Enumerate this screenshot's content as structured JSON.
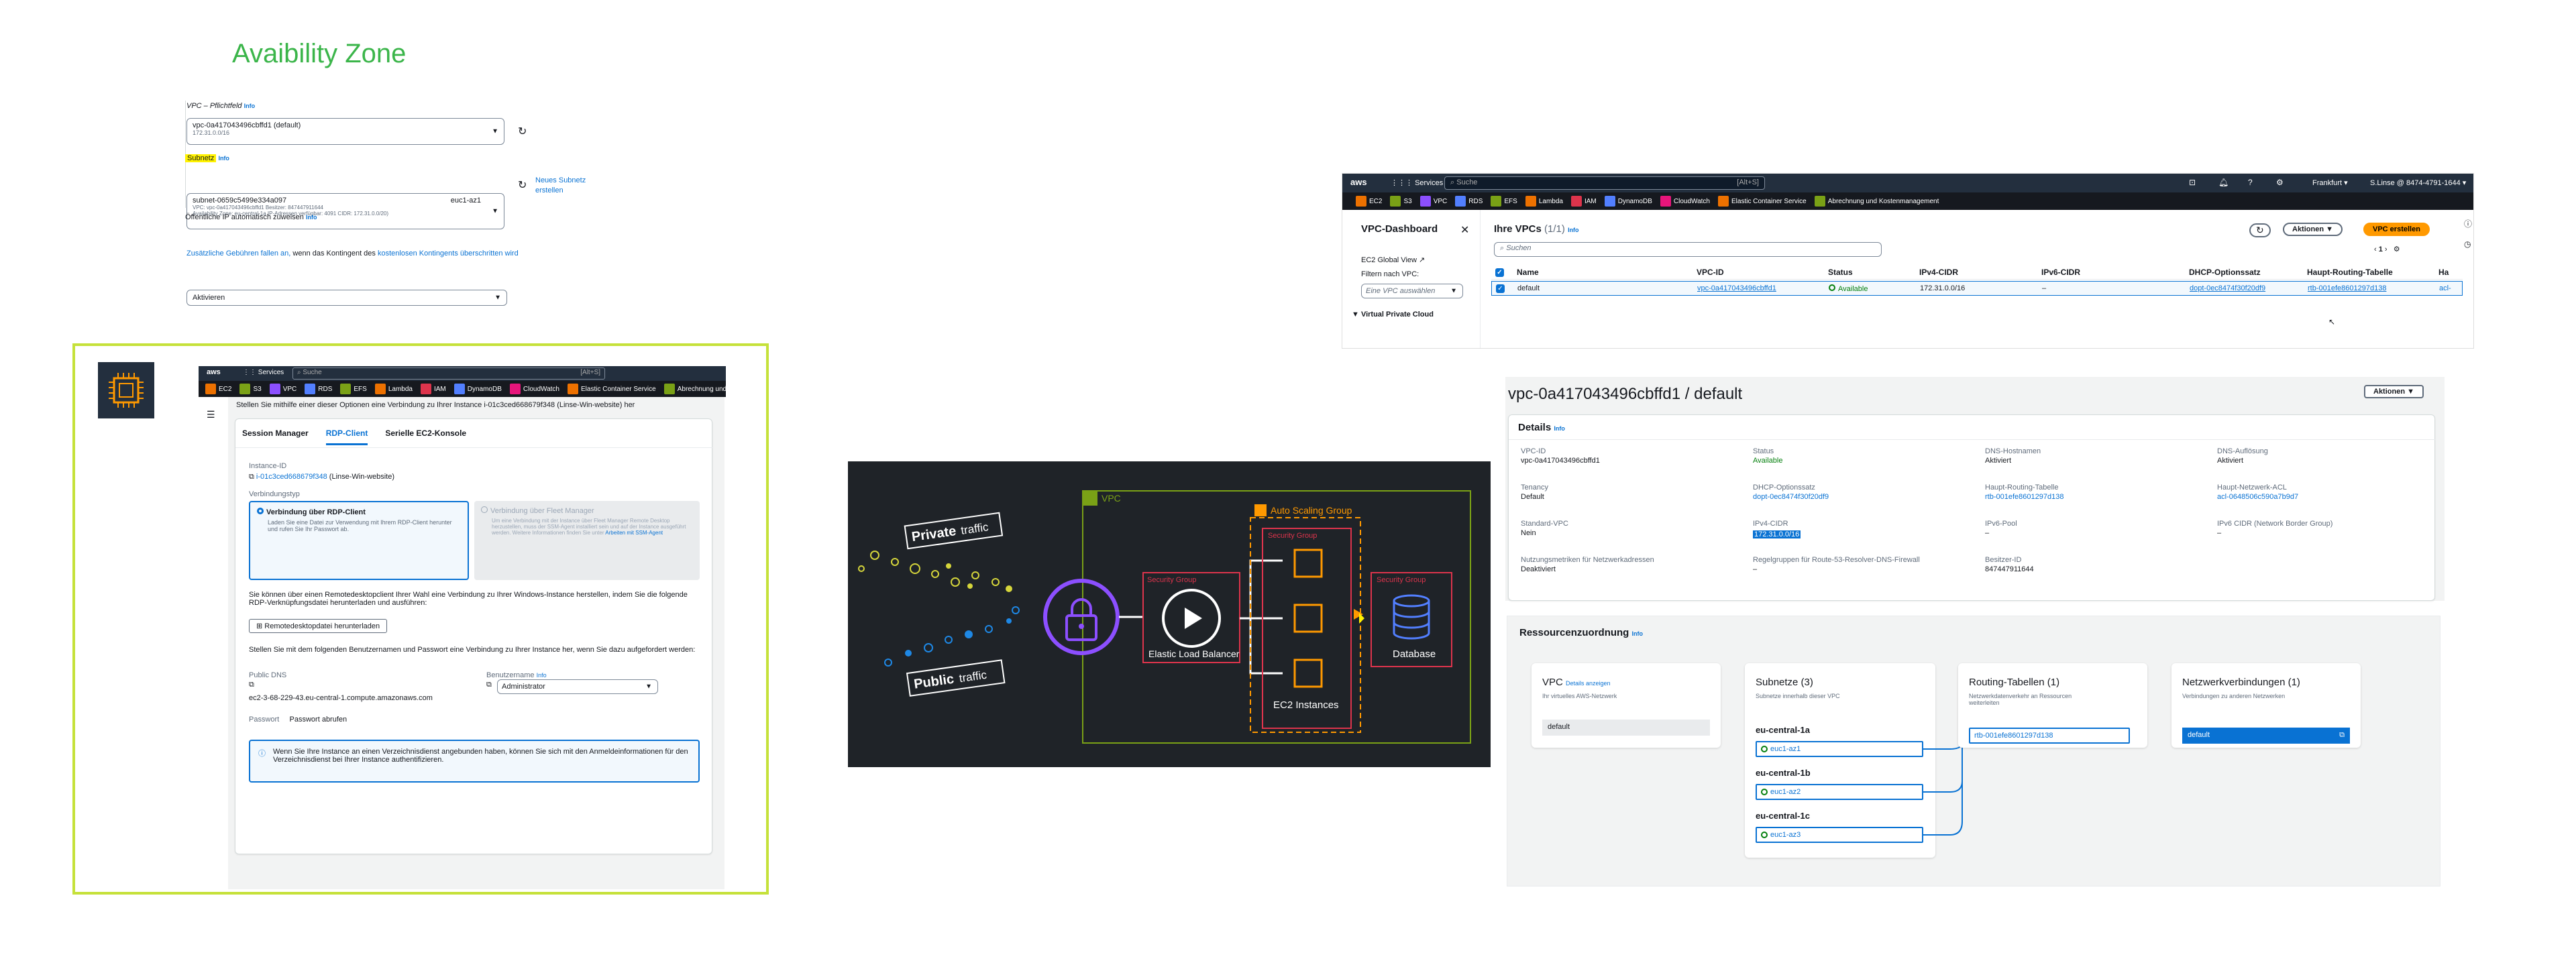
{
  "title": "Avaibility Zone",
  "vpc_form": {
    "vpc_label": "VPC – Pflichtfeld",
    "info": "Info",
    "vpc_value": "vpc-0a417043496cbffd1 (default)",
    "vpc_cidr": "172.31.0.0/16",
    "subnet_label": "Subnetz",
    "subnet_value": "subnet-0659c5499e334a097",
    "subnet_az": "euc1-az1",
    "subnet_line2": "VPC: vpc-0a417043496cbffd1    Besitzer: 847447911644",
    "subnet_line3": "Availability Zone: eu-central-1a    IP-Adressen verfügbar: 4091    CIDR: 172.31.0.0/20)",
    "new_subnet": "Neues Subnetz erstellen",
    "public_ip_label": "Öffentliche IP automatisch zuweisen",
    "public_ip_value": "Aktivieren",
    "fee_note_1": "Zusätzliche Gebühren fallen an,",
    "fee_note_2": " wenn das Kontingent des ",
    "fee_note_3": "kostenlosen Kontingents überschritten wird"
  },
  "aws_bar": {
    "logo": "aws",
    "services": "Services",
    "search_placeholder": "Suche",
    "shortcut": "[Alt+S]",
    "region": "Frankfurt ▾",
    "account": "S.Linse @ 8474-4791-1644 ▾",
    "services_list": [
      {
        "label": "EC2",
        "color": "#ed7100"
      },
      {
        "label": "S3",
        "color": "#7aa116"
      },
      {
        "label": "VPC",
        "color": "#8c4fff"
      },
      {
        "label": "RDS",
        "color": "#527fff"
      },
      {
        "label": "EFS",
        "color": "#7aa116"
      },
      {
        "label": "Lambda",
        "color": "#ed7100"
      },
      {
        "label": "IAM",
        "color": "#dd344c"
      },
      {
        "label": "DynamoDB",
        "color": "#527fff"
      },
      {
        "label": "CloudWatch",
        "color": "#e7157b"
      },
      {
        "label": "Elastic Container Service",
        "color": "#ed7100"
      },
      {
        "label": "Abrechnung und Kostenmanagement",
        "color": "#7aa116"
      }
    ]
  },
  "vpc_dashboard": {
    "sidebar_title": "VPC-Dashboard",
    "ec2_global_view": "EC2 Global View",
    "filter_label": "Filtern nach VPC:",
    "filter_placeholder": "Eine VPC auswählen",
    "vpc_section": "▼ Virtual Private Cloud",
    "heading": "Ihre VPCs",
    "count": "(1/1)",
    "info": "Info",
    "actions": "Aktionen ▼",
    "create": "VPC erstellen",
    "search_placeholder": "Suchen",
    "page": "1",
    "columns": [
      "Name",
      "VPC-ID",
      "Status",
      "IPv4-CIDR",
      "IPv6-CIDR",
      "DHCP-Optionssatz",
      "Haupt-Routing-Tabelle",
      "Ha"
    ],
    "row": {
      "name": "default",
      "vpc_id": "vpc-0a417043496cbffd1",
      "status": "Available",
      "ipv4": "172.31.0.0/16",
      "ipv6": "–",
      "dhcp": "dopt-0ec8474f30f20df9",
      "rt": "rtb-001efe8601297d138",
      "ha": "acl-"
    }
  },
  "ec2_connect": {
    "intro": "Stellen Sie mithilfe einer dieser Optionen eine Verbindung zu Ihrer Instance i-01c3ced668679f348 (Linse-Win-website) her",
    "tabs": [
      "Session Manager",
      "RDP-Client",
      "Serielle EC2-Konsole"
    ],
    "instance_id_label": "Instance-ID",
    "instance_id": "i-01c3ced668679f348",
    "instance_name": "(Linse-Win-website)",
    "conn_type_label": "Verbindungstyp",
    "opt1_title": "Verbindung über RDP-Client",
    "opt1_desc": "Laden Sie eine Datei zur Verwendung mit Ihrem RDP-Client herunter und rufen Sie Ihr Passwort ab.",
    "opt2_title": "Verbindung über Fleet Manager",
    "opt2_desc": "Um eine Verbindung mit der Instance über Fleet Manager Remote Desktop herzustellen, muss der SSM-Agent installiert sein und auf der Instance ausgeführt werden. Weitere Informationen finden Sie unter",
    "opt2_link": "Arbeiten mit SSM-Agent",
    "para1": "Sie können über einen Remotedesktopclient Ihrer Wahl eine Verbindung zu Ihrer Windows-Instance herstellen, indem Sie die folgende RDP-Verknüpfungsdatei herunterladen und ausführen:",
    "download_btn": "Remotedesktopdatei herunterladen",
    "para2": "Stellen Sie mit dem folgenden Benutzernamen und Passwort eine Verbindung zu Ihrer Instance her, wenn Sie dazu aufgefordert werden:",
    "dns_label": "Public DNS",
    "dns": "ec2-3-68-229-43.eu-central-1.compute.amazonaws.com",
    "user_label": "Benutzername",
    "user_info": "Info",
    "user_value": "Administrator",
    "pw_label": "Passwort",
    "pw_link": "Passwort abrufen",
    "note": "Wenn Sie Ihre Instance an einen Verzeichnisdienst angebunden haben, können Sie sich mit den Anmeldeinformationen für den Verzeichnisdienst bei Ihrer Instance authentifizieren."
  },
  "diagram": {
    "private": "Private",
    "private2": "traffic",
    "public": "Public",
    "public2": "traffic",
    "vpc": "VPC",
    "asg": "Auto Scaling Group",
    "sg": "Security Group",
    "elb": "Elastic Load Balancer",
    "ec2": "EC2 Instances",
    "db": "Database"
  },
  "vpc_detail": {
    "title": "vpc-0a417043496cbffd1 / default",
    "actions": "Aktionen ▼",
    "details": "Details",
    "info": "Info",
    "fields": [
      {
        "label": "VPC-ID",
        "value": "vpc-0a417043496cbffd1"
      },
      {
        "label": "Status",
        "value": "Available"
      },
      {
        "label": "DNS-Hostnamen",
        "value": "Aktiviert"
      },
      {
        "label": "DNS-Auflösung",
        "value": "Aktiviert"
      },
      {
        "label": "Tenancy",
        "value": "Default"
      },
      {
        "label": "DHCP-Optionssatz",
        "value": "dopt-0ec8474f30f20df9"
      },
      {
        "label": "Haupt-Routing-Tabelle",
        "value": "rtb-001efe8601297d138"
      },
      {
        "label": "Haupt-Netzwerk-ACL",
        "value": "acl-0648506c590a7b9d7"
      },
      {
        "label": "Standard-VPC",
        "value": "Nein"
      },
      {
        "label": "IPv4-CIDR",
        "value": "172.31.0.0/16"
      },
      {
        "label": "IPv6-Pool",
        "value": "–"
      },
      {
        "label": "IPv6 CIDR (Network Border Group)",
        "value": "–"
      },
      {
        "label": "Nutzungsmetriken für Netzwerkadressen",
        "value": "Deaktiviert"
      },
      {
        "label": "Regelgruppen für Route-53-Resolver-DNS-Firewall",
        "value": "–"
      },
      {
        "label": "Besitzer-ID",
        "value": "847447911644"
      }
    ]
  },
  "resource_map": {
    "title": "Ressourcenzuordnung",
    "info": "Info",
    "vpc_title": "VPC",
    "vpc_link": "Details anzeigen",
    "vpc_desc": "Ihr virtuelles AWS-Netzwerk",
    "vpc_item": "default",
    "subnets_title": "Subnetze (3)",
    "subnets_desc": "Subnetze innerhalb dieser VPC",
    "azs": [
      {
        "name": "eu-central-1a",
        "subnet": "euc1-az1"
      },
      {
        "name": "eu-central-1b",
        "subnet": "euc1-az2"
      },
      {
        "name": "eu-central-1c",
        "subnet": "euc1-az3"
      }
    ],
    "rt_title": "Routing-Tabellen (1)",
    "rt_desc": "Netzwerkdatenverkehr an Ressourcen weiterleiten",
    "rt_item": "rtb-001efe8601297d138",
    "nc_title": "Netzwerkverbindungen (1)",
    "nc_desc": "Verbindungen zu anderen Netzwerken",
    "nc_item": "default"
  }
}
